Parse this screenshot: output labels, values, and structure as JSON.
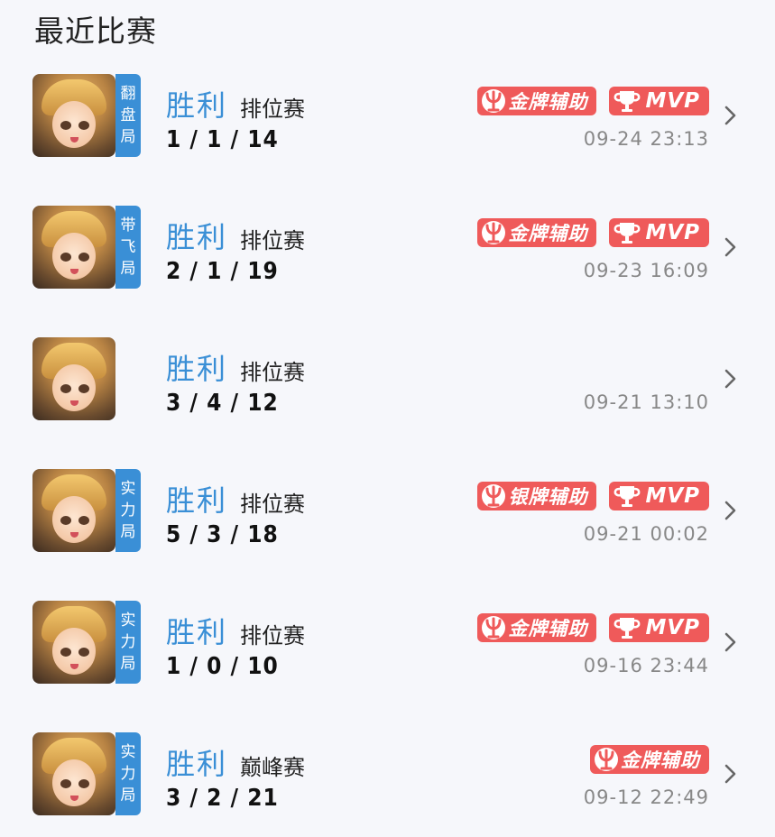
{
  "section_title": "最近比赛",
  "matches": [
    {
      "tag": [
        "翻",
        "盘",
        "局"
      ],
      "result": "胜利",
      "mode": "排位赛",
      "kda": "1 / 1 / 14",
      "badges": [
        "金牌辅助",
        "MVP"
      ],
      "time": "09-24  23:13"
    },
    {
      "tag": [
        "带",
        "飞",
        "局"
      ],
      "result": "胜利",
      "mode": "排位赛",
      "kda": "2 / 1 / 19",
      "badges": [
        "金牌辅助",
        "MVP"
      ],
      "time": "09-23  16:09"
    },
    {
      "tag": [],
      "result": "胜利",
      "mode": "排位赛",
      "kda": "3 / 4 / 12",
      "badges": [],
      "time": "09-21  13:10"
    },
    {
      "tag": [
        "实",
        "力",
        "局"
      ],
      "result": "胜利",
      "mode": "排位赛",
      "kda": "5 / 3 / 18",
      "badges": [
        "银牌辅助",
        "MVP"
      ],
      "time": "09-21  00:02"
    },
    {
      "tag": [
        "实",
        "力",
        "局"
      ],
      "result": "胜利",
      "mode": "排位赛",
      "kda": "1 / 0 / 10",
      "badges": [
        "金牌辅助",
        "MVP"
      ],
      "time": "09-16  23:44"
    },
    {
      "tag": [
        "实",
        "力",
        "局"
      ],
      "result": "胜利",
      "mode": "巅峰赛",
      "kda": "3 / 2 / 21",
      "badges": [
        "金牌辅助"
      ],
      "time": "09-12  22:49"
    }
  ],
  "colors": {
    "accent_blue": "#3a8fd6",
    "badge_red": "#ef5a5a",
    "time_gray": "#888888"
  },
  "icons": {
    "support_badge": "trident-icon",
    "mvp_badge": "trophy-icon",
    "row_arrow": "chevron-right-icon"
  }
}
